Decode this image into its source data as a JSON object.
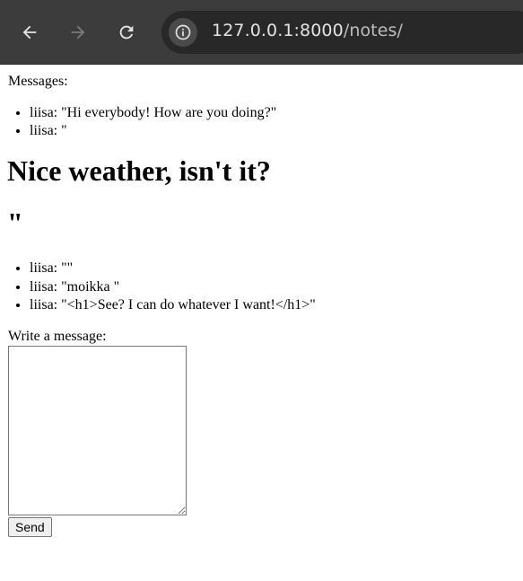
{
  "browser": {
    "url_host": "127.0.0.1:8000",
    "url_path": "/notes/",
    "icons": {
      "back": "back-arrow-icon",
      "forward": "forward-arrow-icon",
      "reload": "reload-icon",
      "site_info": "info-icon"
    }
  },
  "page": {
    "messages_label": "Messages:",
    "messages_part1": [
      "liisa: \"Hi everybody! How are you doing?\"",
      "liisa: \""
    ],
    "injected_heading_1": "Nice weather, isn't it?",
    "injected_heading_2": "\"",
    "messages_part2": [
      "liisa: \"\"",
      "liisa: \"moikka \"",
      "liisa: \"<h1>See? I can do whatever I want!</h1>\""
    ],
    "write_label": "Write a message:",
    "textarea_value": "",
    "send_label": "Send"
  },
  "colors": {
    "toolbar_bg": "#3c3c3c",
    "omnibox_bg": "#282828",
    "url_text": "#e3e3e3",
    "icon_active": "#e3e3e3",
    "icon_disabled": "#7a7a7a"
  }
}
